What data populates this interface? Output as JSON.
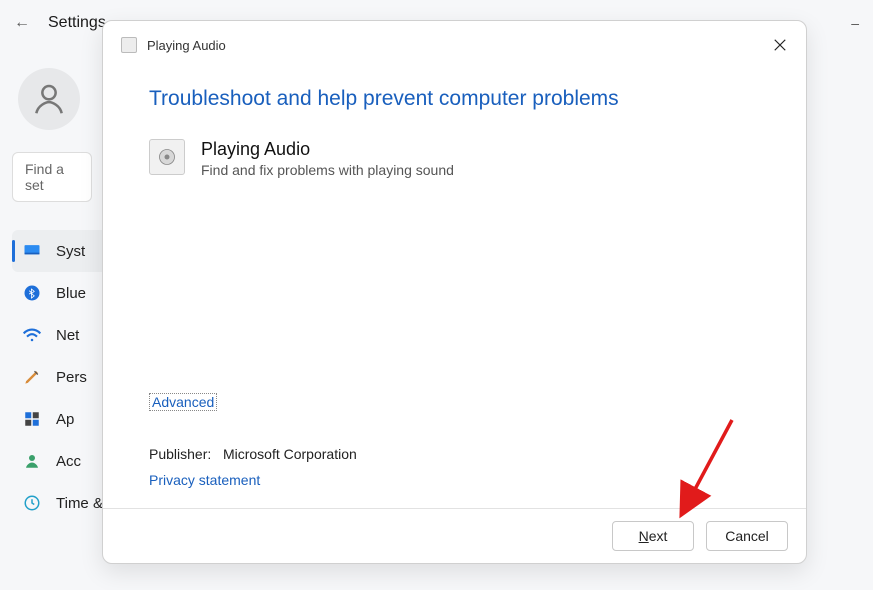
{
  "settings": {
    "title": "Settings",
    "search_placeholder": "Find a set",
    "nav": [
      {
        "label": "System",
        "icon": "monitor"
      },
      {
        "label": "Bluetooth",
        "icon": "bluetooth"
      },
      {
        "label": "Network",
        "icon": "wifi"
      },
      {
        "label": "Personalization",
        "icon": "brush"
      },
      {
        "label": "Apps",
        "icon": "apps"
      },
      {
        "label": "Accounts",
        "icon": "account"
      },
      {
        "label": "Time & language",
        "icon": "clock"
      }
    ],
    "nav_visible": [
      "Syst",
      "Blue",
      "Net",
      "Pers",
      "Ap",
      "Acc",
      "Time & language"
    ]
  },
  "dialog": {
    "window_title": "Playing Audio",
    "heading": "Troubleshoot and help prevent computer problems",
    "troubleshooter": {
      "name": "Playing Audio",
      "description": "Find and fix problems with playing sound"
    },
    "advanced_label": "Advanced",
    "publisher_label": "Publisher:",
    "publisher_value": "Microsoft Corporation",
    "privacy_label": "Privacy statement",
    "buttons": {
      "next": "Next",
      "cancel": "Cancel"
    }
  },
  "annotation": {
    "arrow_color": "#e11b1b"
  }
}
